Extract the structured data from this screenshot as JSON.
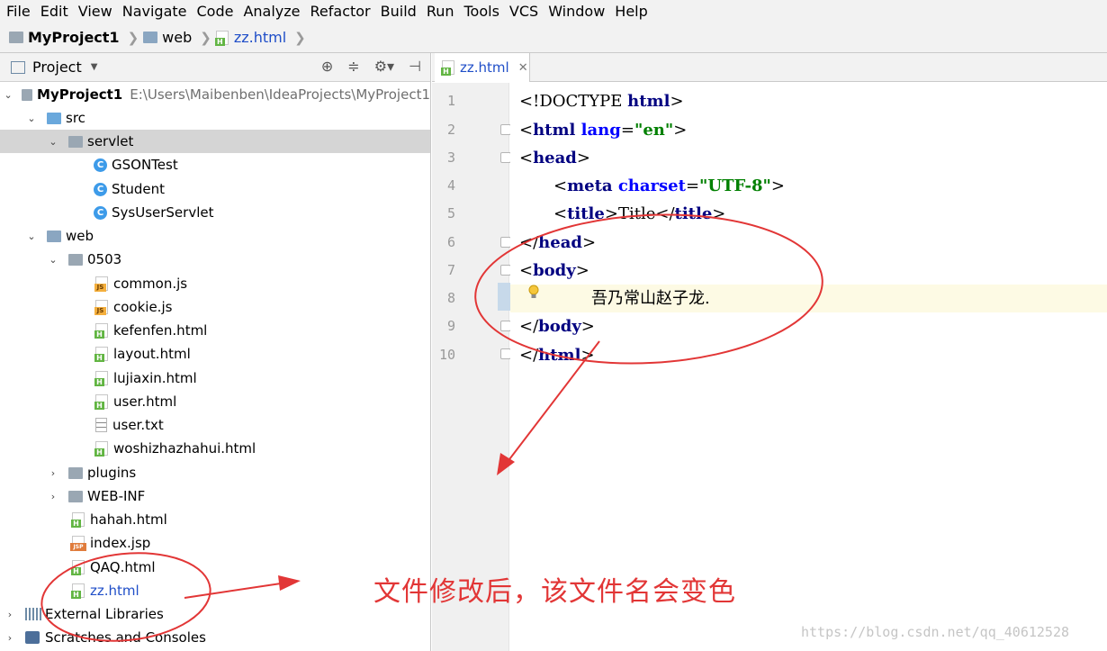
{
  "menu": [
    "File",
    "Edit",
    "View",
    "Navigate",
    "Code",
    "Analyze",
    "Refactor",
    "Build",
    "Run",
    "Tools",
    "VCS",
    "Window",
    "Help"
  ],
  "menu_underline": [
    "F",
    "E",
    "V",
    "N",
    "C",
    "z",
    "R",
    "B",
    "u",
    "T",
    "",
    "W",
    "H"
  ],
  "breadcrumb": [
    "MyProject1",
    "web",
    "zz.html"
  ],
  "project_panel": {
    "title": "Project"
  },
  "tree": {
    "root": {
      "name": "MyProject1",
      "path": "E:\\Users\\Maibenben\\IdeaProjects\\MyProject1"
    },
    "src": "src",
    "servlet": "servlet",
    "classes": [
      "GSONTest",
      "Student",
      "SysUserServlet"
    ],
    "web": "web",
    "folder_0503": "0503",
    "files_0503": [
      "common.js",
      "cookie.js",
      "kefenfen.html",
      "layout.html",
      "lujiaxin.html",
      "user.html",
      "user.txt",
      "woshizhazhahui.html"
    ],
    "plugins": "plugins",
    "webinf": "WEB-INF",
    "web_files": [
      "hahah.html",
      "index.jsp",
      "QAQ.html",
      "zz.html"
    ],
    "external": "External Libraries",
    "scratches": "Scratches and Consoles"
  },
  "editor": {
    "tab": "zz.html",
    "line_numbers": [
      "1",
      "2",
      "3",
      "4",
      "5",
      "6",
      "7",
      "8",
      "9",
      "10"
    ],
    "code": {
      "l1_a": "<!DOCTYPE ",
      "l1_b": "html",
      "l1_c": ">",
      "l2_a": "<",
      "l2_b": "html ",
      "l2_c": "lang",
      "l2_d": "=",
      "l2_e": "\"en\"",
      "l2_f": ">",
      "l3_a": "<",
      "l3_b": "head",
      "l3_c": ">",
      "l4_a": "<",
      "l4_b": "meta ",
      "l4_c": "charset",
      "l4_d": "=",
      "l4_e": "\"UTF-8\"",
      "l4_f": ">",
      "l5_a": "<",
      "l5_b": "title",
      "l5_c": ">",
      "l5_d": "Title",
      "l5_e": "</",
      "l5_f": "title",
      "l5_g": ">",
      "l6_a": "</",
      "l6_b": "head",
      "l6_c": ">",
      "l7_a": "<",
      "l7_b": "body",
      "l7_c": ">",
      "l8": "吾乃常山赵子龙.",
      "l9_a": "</",
      "l9_b": "body",
      "l9_c": ">",
      "l10_a": "</",
      "l10_b": "html",
      "l10_c": ">"
    }
  },
  "annotation": "文件修改后，该文件名会变色",
  "watermark": "https://blog.csdn.net/qq_40612528",
  "colors": {
    "annotation": "#e23636",
    "modified_file": "#1f4ec8"
  }
}
